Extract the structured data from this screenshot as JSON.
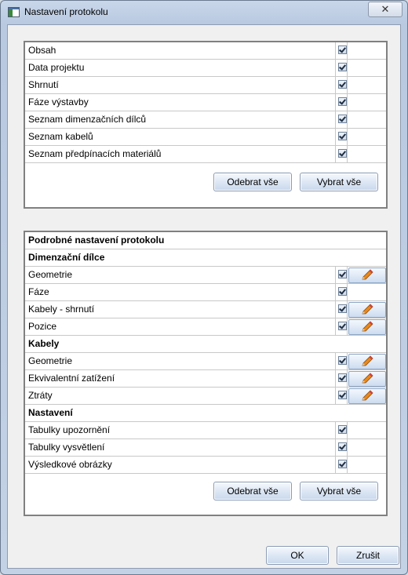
{
  "window": {
    "title": "Nastavení protokolu",
    "close_glyph": "✕"
  },
  "sections": {
    "items": [
      {
        "label": "Obsah",
        "checked": true
      },
      {
        "label": "Data projektu",
        "checked": true
      },
      {
        "label": "Shrnutí",
        "checked": true
      },
      {
        "label": "Fáze výstavby",
        "checked": true
      },
      {
        "label": "Seznam dimenzačních dílců",
        "checked": true
      },
      {
        "label": "Seznam kabelů",
        "checked": true
      },
      {
        "label": "Seznam předpínacích materiálů",
        "checked": true
      }
    ],
    "remove_all": "Odebrat vše",
    "select_all": "Vybrat vše"
  },
  "detail": {
    "title": "Podrobné nastavení protokolu",
    "groups": [
      {
        "header": "Dimenzační dílce",
        "items": [
          {
            "label": "Geometrie",
            "checked": true,
            "editable": true
          },
          {
            "label": "Fáze",
            "checked": true,
            "editable": false
          },
          {
            "label": "Kabely - shrnutí",
            "checked": true,
            "editable": true
          },
          {
            "label": "Pozice",
            "checked": true,
            "editable": true
          }
        ]
      },
      {
        "header": "Kabely",
        "items": [
          {
            "label": "Geometrie",
            "checked": true,
            "editable": true
          },
          {
            "label": "Ekvivalentní zatížení",
            "checked": true,
            "editable": true
          },
          {
            "label": "Ztráty",
            "checked": true,
            "editable": true
          }
        ]
      },
      {
        "header": "Nastavení",
        "items": [
          {
            "label": "Tabulky upozornění",
            "checked": true,
            "editable": false
          },
          {
            "label": "Tabulky vysvětlení",
            "checked": true,
            "editable": false
          },
          {
            "label": "Výsledkové obrázky",
            "checked": true,
            "editable": false
          }
        ]
      }
    ],
    "remove_all": "Odebrat vše",
    "select_all": "Vybrat vše"
  },
  "footer": {
    "ok": "OK",
    "cancel": "Zrušit"
  },
  "icons": {
    "check": "checkmark-icon",
    "edit": "pencil-icon"
  }
}
